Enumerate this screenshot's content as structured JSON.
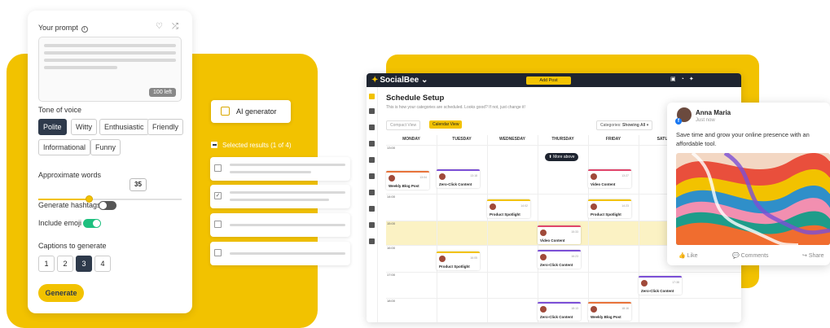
{
  "prompt_panel": {
    "title": "Your prompt",
    "count_badge": "100 left",
    "tone_label": "Tone of voice",
    "tones": [
      "Polite",
      "Witty",
      "Enthusiastic",
      "Friendly",
      "Informational",
      "Funny"
    ],
    "active_tone": "Polite",
    "words_label": "Approximate words",
    "words_value": "35",
    "words_fraction": 0.35,
    "hashtags_label": "Generate hashtags",
    "hashtags_on": false,
    "emoji_label": "Include emoji",
    "emoji_on": true,
    "captions_label": "Captions to generate",
    "caption_options": [
      "1",
      "2",
      "3",
      "4"
    ],
    "caption_selected": "3",
    "generate_label": "Generate"
  },
  "ai": {
    "button_label": "AI generator",
    "selected_label": "Selected results (1 of 4)",
    "results_checked": [
      false,
      true,
      false,
      false
    ]
  },
  "socialbee": {
    "brand": "SocialBee",
    "add_post": "Add Post",
    "title": "Schedule Setup",
    "subtitle": "This is how your categories are scheduled. Looks good? If not, just change it!",
    "compact_view": "Compact View",
    "calendar_view": "Calendar View",
    "categories_label": "Categories:",
    "categories_value": "Showing All",
    "days": [
      "MONDAY",
      "TUESDAY",
      "WEDNESDAY",
      "THURSDAY",
      "FRIDAY",
      "SATUR"
    ],
    "times": [
      "13:00",
      "14:00",
      "15:00",
      "16:00",
      "17:00",
      "18:00"
    ],
    "more_above": "More above",
    "posts": [
      {
        "name": "Weekly Blog Post",
        "time": "13:04",
        "color": "#e8733a"
      },
      {
        "name": "Zero-Click Content",
        "time": "13:18",
        "color": "#7b4fd6"
      },
      {
        "name": "Video Content",
        "time": "13:27",
        "color": "#e0456b"
      },
      {
        "name": "Product Spotlight",
        "time": "14:02",
        "color": "#f2c200"
      },
      {
        "name": "Product Spotlight",
        "time": "14:23",
        "color": "#f2c200"
      },
      {
        "name": "Video Content",
        "time": "15:33",
        "color": "#e0456b"
      },
      {
        "name": "Product Spotlight",
        "time": "16:05",
        "color": "#f2c200"
      },
      {
        "name": "Zero-Click Content",
        "time": "16:23",
        "color": "#7b4fd6"
      },
      {
        "name": "Zero-Click Content",
        "time": "17:38",
        "color": "#7b4fd6"
      },
      {
        "name": "Zero-Click Content",
        "time": "18:13",
        "color": "#7b4fd6"
      },
      {
        "name": "Weekly Blog Post",
        "time": "18:16",
        "color": "#e8733a"
      }
    ]
  },
  "fb_post": {
    "name": "Anna Maria",
    "time": "Just now",
    "text": "Save time and grow your online presence with an affordable tool.",
    "like": "Like",
    "comments": "Comments",
    "share": "Share"
  },
  "colors": {
    "accent": "#f2c200",
    "dark": "#2e3a4b",
    "toggle_on": "#1ec07f"
  }
}
